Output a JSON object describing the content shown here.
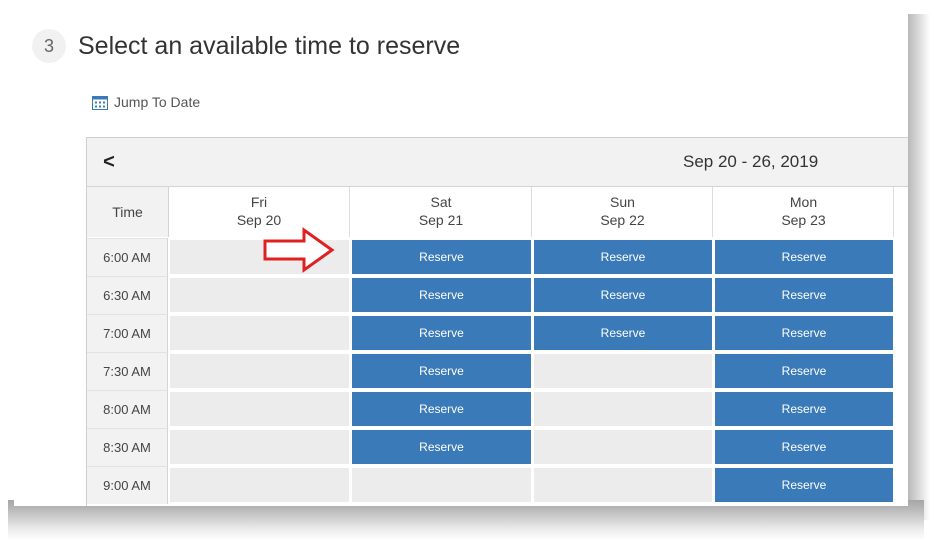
{
  "step": {
    "number": "3",
    "title": "Select an available time to reserve"
  },
  "jump_to_date": {
    "label": "Jump To Date",
    "icon": "calendar-icon"
  },
  "calendar": {
    "prev_icon": "chevron-left-icon",
    "prev_glyph": "<",
    "range_label": "Sep 20 - 26, 2019",
    "time_header": "Time",
    "days": [
      {
        "dow": "Fri",
        "date": "Sep 20"
      },
      {
        "dow": "Sat",
        "date": "Sep 21"
      },
      {
        "dow": "Sun",
        "date": "Sep 22"
      },
      {
        "dow": "Mon",
        "date": "Sep 23"
      }
    ],
    "reserve_label": "Reserve",
    "rows": [
      {
        "time": "6:00 AM",
        "slots": [
          false,
          true,
          true,
          true
        ]
      },
      {
        "time": "6:30 AM",
        "slots": [
          false,
          true,
          true,
          true
        ]
      },
      {
        "time": "7:00 AM",
        "slots": [
          false,
          true,
          true,
          true
        ]
      },
      {
        "time": "7:30 AM",
        "slots": [
          false,
          true,
          false,
          true
        ]
      },
      {
        "time": "8:00 AM",
        "slots": [
          false,
          true,
          false,
          true
        ]
      },
      {
        "time": "8:30 AM",
        "slots": [
          false,
          true,
          false,
          true
        ]
      },
      {
        "time": "9:00 AM",
        "slots": [
          false,
          false,
          false,
          true
        ]
      }
    ]
  },
  "annotation": {
    "arrow_icon": "red-arrow-annotation-icon",
    "color": "#e02020"
  },
  "colors": {
    "reserve": "#3a7ab8",
    "empty": "#ececec",
    "header_bg": "#f2f2f2"
  }
}
